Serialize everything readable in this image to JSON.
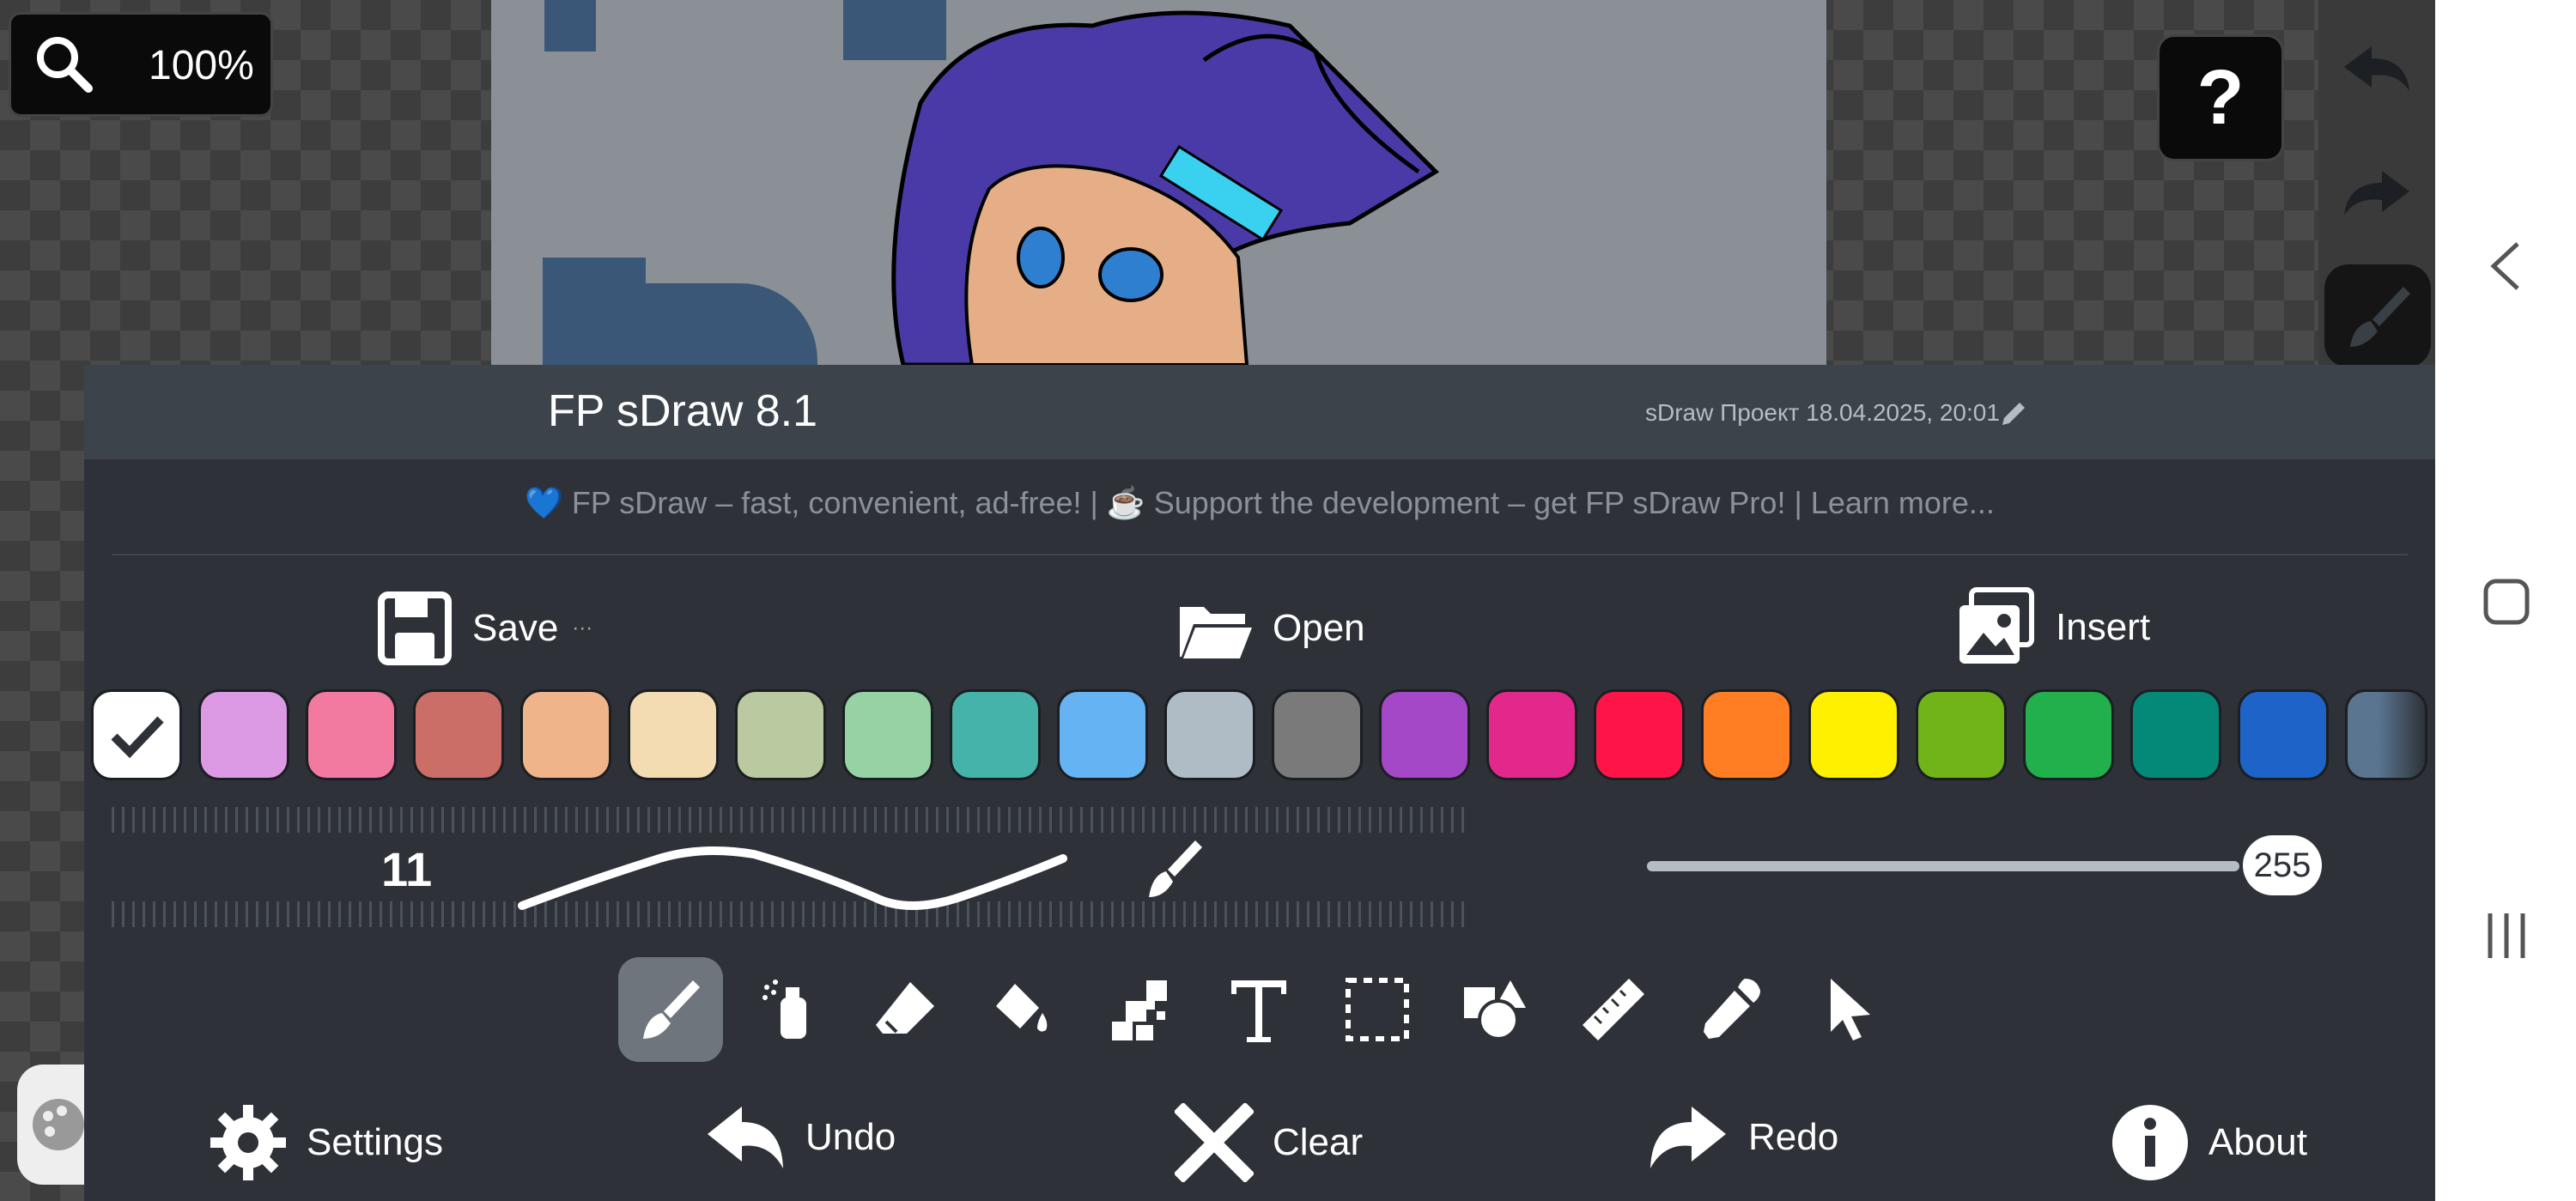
{
  "zoom": {
    "value": "100%"
  },
  "help": {
    "label": "?"
  },
  "panel": {
    "app_title": "FP sDraw 8.1",
    "project_name": "sDraw Проект 18.04.2025, 20:01",
    "promo": "💙 FP sDraw – fast, convenient, ad-free!  |  ☕ Support the development – get FP sDraw Pro!  |  Learn more..."
  },
  "file_actions": {
    "save": "Save",
    "save_more": "···",
    "open": "Open",
    "insert": "Insert"
  },
  "palette": [
    "#ffffff",
    "#dc9ae4",
    "#f27aa0",
    "#cc6e68",
    "#f0b48a",
    "#f3dcb2",
    "#bac9a0",
    "#96d2a4",
    "#46b3aa",
    "#66b3f3",
    "#b0bcc5",
    "#7a7a7a",
    "#a548c8",
    "#e2288a",
    "#ff1448",
    "#ff7e24",
    "#fff000",
    "#70b41a",
    "#22b04c",
    "#048878",
    "#1e64c8",
    "#5a7590"
  ],
  "brush": {
    "size": "11",
    "opacity": "255"
  },
  "tools": [
    "brush",
    "spray",
    "eraser",
    "fill",
    "pixel",
    "text",
    "selection",
    "shapes",
    "ruler",
    "eyedropper",
    "pointer"
  ],
  "bottom_actions": {
    "settings": "Settings",
    "undo": "Undo",
    "clear": "Clear",
    "redo": "Redo",
    "about": "About"
  }
}
